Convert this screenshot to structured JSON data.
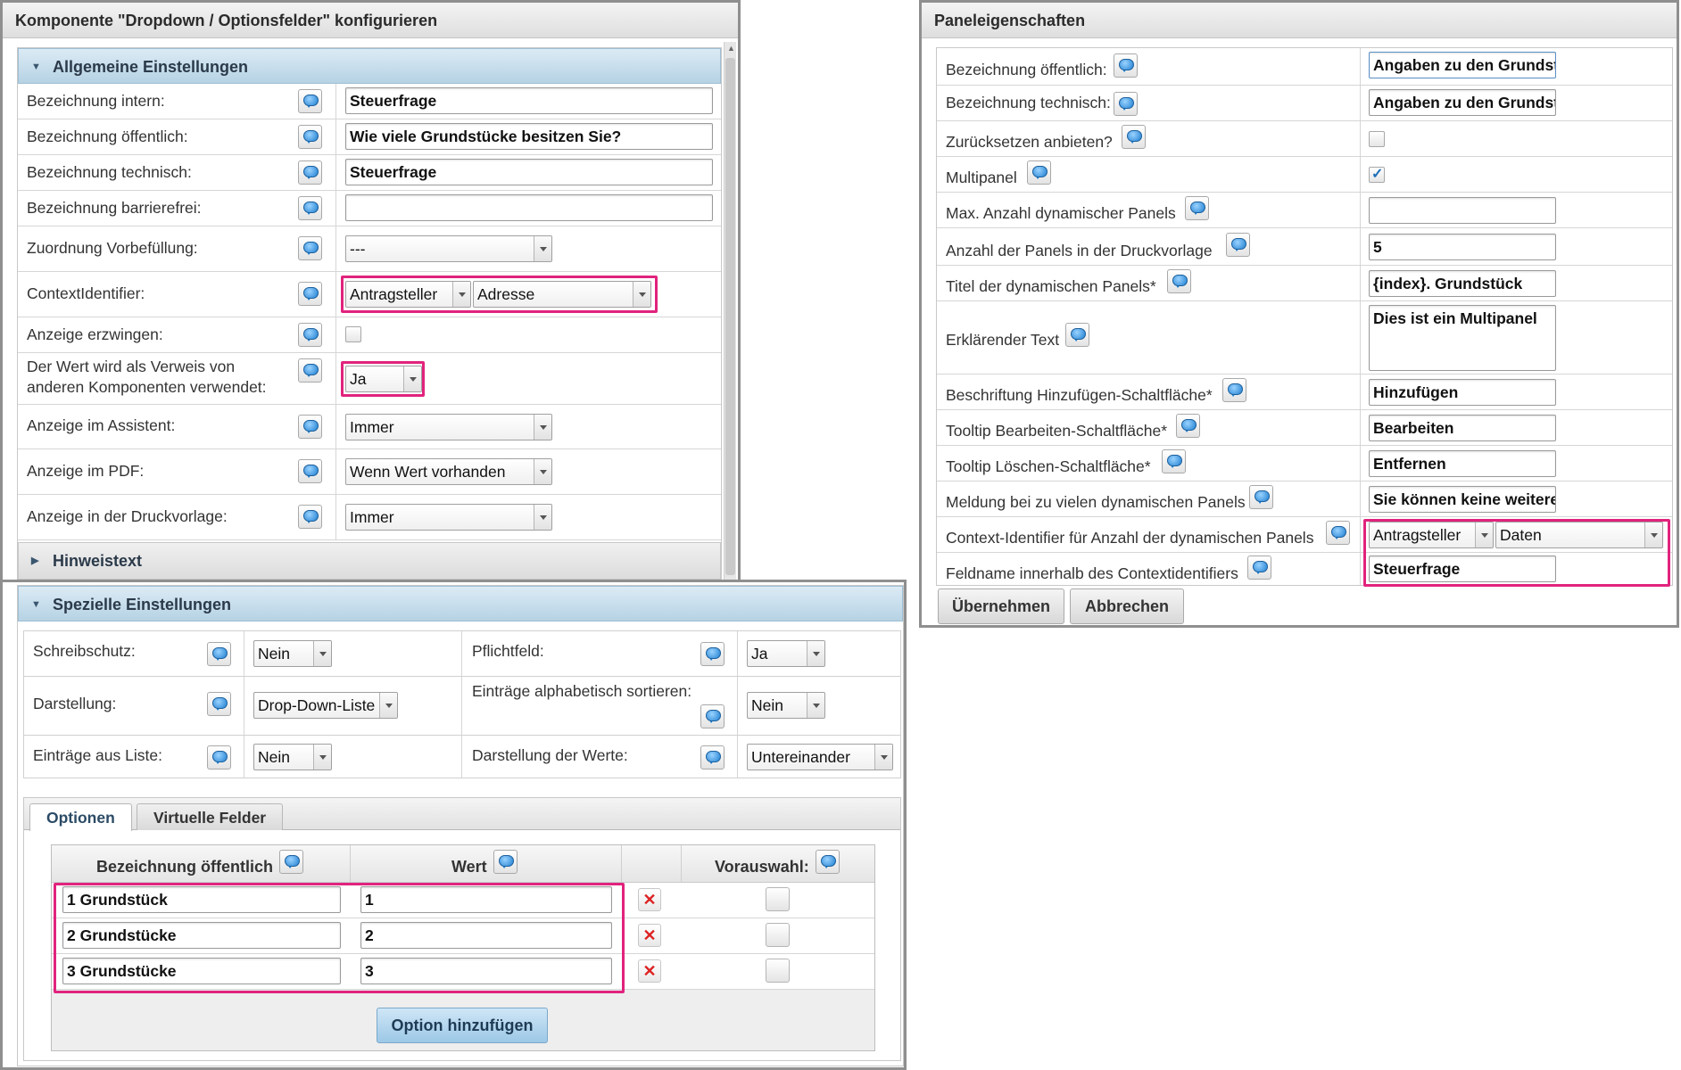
{
  "w1": {
    "title": "Komponente \"Dropdown / Optionsfelder\" konfigurieren",
    "general_title": "Allgemeine Einstellungen",
    "rows": [
      {
        "label": "Bezeichnung intern:",
        "value": "Steuerfrage"
      },
      {
        "label": "Bezeichnung öffentlich:",
        "value": "Wie viele Grundstücke besitzen Sie?"
      },
      {
        "label": "Bezeichnung technisch:",
        "value": "Steuerfrage"
      },
      {
        "label": "Bezeichnung barrierefrei:",
        "value": ""
      },
      {
        "label": "Zuordnung Vorbefüllung:",
        "value": "---"
      },
      {
        "label": "ContextIdentifier:",
        "value1": "Antragsteller",
        "value2": "Adresse"
      },
      {
        "label": "Anzeige erzwingen:"
      },
      {
        "label_line1": "Der Wert wird als Verweis von",
        "label_line2": "anderen Komponenten verwendet:",
        "value": "Ja"
      },
      {
        "label": "Anzeige im Assistent:",
        "value": "Immer"
      },
      {
        "label": "Anzeige im PDF:",
        "value": "Wenn Wert vorhanden"
      },
      {
        "label": "Anzeige in der Druckvorlage:",
        "value": "Immer"
      }
    ],
    "hint_title": "Hinweistext"
  },
  "w2": {
    "special_title": "Spezielle Einstellungen",
    "settings": [
      {
        "label": "Schreibschutz:",
        "value": "Nein"
      },
      {
        "label": "Pflichtfeld:",
        "value": "Ja"
      },
      {
        "label": "Darstellung:",
        "value": "Drop-Down-Liste"
      },
      {
        "label": "Einträge alphabetisch sortieren:",
        "value": "Nein"
      },
      {
        "label": "Einträge aus Liste:",
        "value": "Nein"
      },
      {
        "label": "Darstellung der Werte:",
        "value": "Untereinander"
      }
    ],
    "tabs": [
      "Optionen",
      "Virtuelle Felder"
    ],
    "table_headers": [
      "Bezeichnung öffentlich",
      "Wert",
      "Vorauswahl:"
    ],
    "options": [
      {
        "label": "1 Grundstück",
        "value": "1"
      },
      {
        "label": "2 Grundstücke",
        "value": "2"
      },
      {
        "label": "3 Grundstücke",
        "value": "3"
      }
    ],
    "add_button": "Option hinzufügen"
  },
  "w3": {
    "title": "Paneleigenschaften",
    "rows": [
      {
        "label": "Bezeichnung öffentlich:",
        "value": "Angaben zu den Grundstücken"
      },
      {
        "label": "Bezeichnung technisch:",
        "value": "Angaben zu den Grundstücken"
      },
      {
        "label": "Zurücksetzen anbieten?",
        "checked": false
      },
      {
        "label": "Multipanel",
        "checked": true
      },
      {
        "label": "Max. Anzahl dynamischer Panels",
        "value": ""
      },
      {
        "label": "Anzahl der Panels in der Druckvorlage",
        "value": "5"
      },
      {
        "label": "Titel der dynamischen Panels*",
        "value": "{index}. Grundstück"
      },
      {
        "label": "Erklärender Text",
        "value": "Dies ist ein Multipanel"
      },
      {
        "label": "Beschriftung Hinzufügen-Schaltfläche*",
        "value": "Hinzufügen"
      },
      {
        "label": "Tooltip Bearbeiten-Schaltfläche*",
        "value": "Bearbeiten"
      },
      {
        "label": "Tooltip Löschen-Schaltfläche*",
        "value": "Entfernen"
      },
      {
        "label": "Meldung bei zu vielen dynamischen Panels",
        "value": "Sie können keine weiteren"
      },
      {
        "label": "Context-Identifier für Anzahl der dynamischen Panels",
        "value1": "Antragsteller",
        "value2": "Daten"
      },
      {
        "label": "Feldname innerhalb des Contextidentifiers",
        "value": "Steuerfrage"
      }
    ],
    "ok_button": "Übernehmen",
    "cancel_button": "Abbrechen"
  },
  "colors": {
    "highlight": "#e1237d",
    "section_header": "#b6d2e4",
    "help_icon": "#1f7fd1"
  }
}
